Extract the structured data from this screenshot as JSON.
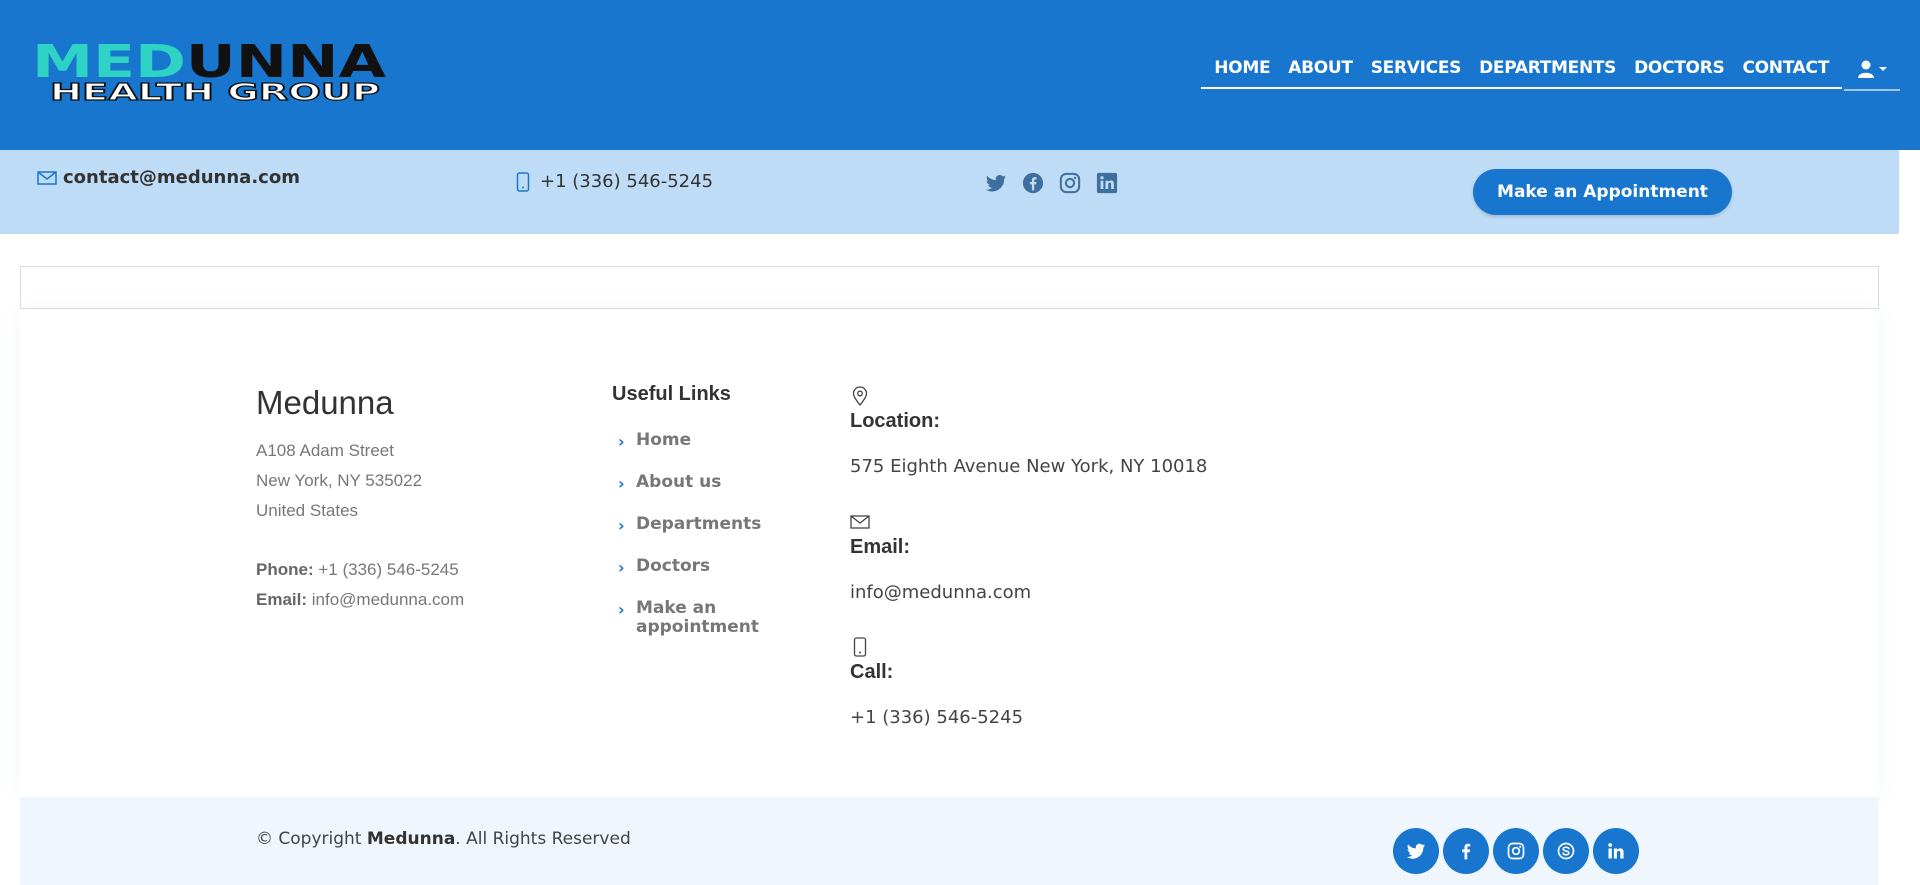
{
  "brand": {
    "logo_top": "MEDUNNA",
    "logo_top_highlight": "MED",
    "logo_top_rest": "UNNA",
    "logo_bottom": "HEALTH GROUP",
    "colors": {
      "primary": "#1976cf",
      "logo_accent": "#2ed3c6",
      "topbar_bg": "#bfdcf6"
    }
  },
  "nav": {
    "items": [
      "HOME",
      "ABOUT",
      "SERVICES",
      "DEPARTMENTS",
      "DOCTORS",
      "CONTACT"
    ],
    "user_icon": "user-icon"
  },
  "topbar": {
    "email": "contact@medunna.com",
    "phone": "+1 (336) 546-5245",
    "social": [
      "twitter-icon",
      "facebook-icon",
      "instagram-icon",
      "linkedin-icon"
    ],
    "appointment_button": "Make an Appointment"
  },
  "footer": {
    "brand": "Medunna",
    "address_line1": "A108 Adam Street",
    "address_line2": "New York, NY 535022",
    "address_line3": "United States",
    "phone_label": "Phone:",
    "phone": "+1 (336) 546-5245",
    "email_label": "Email:",
    "email": "info@medunna.com",
    "links_title": "Useful Links",
    "links": [
      "Home",
      "About us",
      "Departments",
      "Doctors",
      "Make an appointment"
    ],
    "info": {
      "location_label": "Location:",
      "location_value": "575 Eighth Avenue New York, NY 10018",
      "email_label": "Email:",
      "email_value": "info@medunna.com",
      "call_label": "Call:",
      "call_value": "+1 (336) 546-5245"
    }
  },
  "bottom": {
    "copyright_prefix": "© Copyright",
    "copyright_brand": "Medunna",
    "copyright_suffix": ". All Rights Reserved",
    "social": [
      "twitter-icon",
      "facebook-icon",
      "instagram-icon",
      "skype-icon",
      "linkedin-icon"
    ]
  }
}
